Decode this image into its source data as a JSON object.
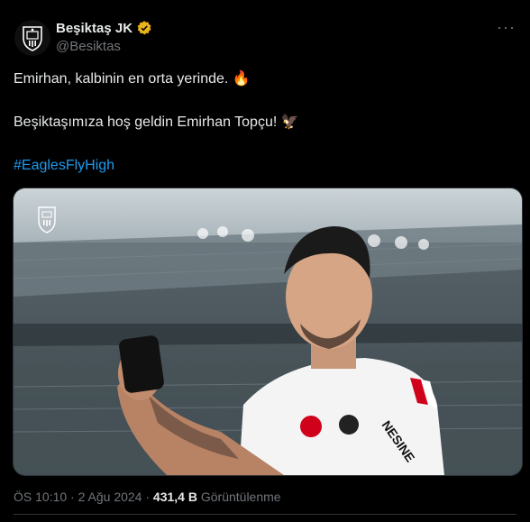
{
  "author": {
    "display_name": "Beşiktaş JK",
    "handle": "@Besiktas",
    "verified_color": "#e8b31b",
    "avatar_icon": "besiktas-crest-icon"
  },
  "more_icon": "more-options-icon",
  "tweet": {
    "line1": "Emirhan, kalbinin en orta yerinde. 🔥",
    "line2": "Beşiktaşımıza hoş geldin Emirhan Topçu! 🦅",
    "hashtag": "#EaglesFlyHigh"
  },
  "media": {
    "description_icon": "besiktas-logo-icon",
    "jersey_text": "NESINE"
  },
  "meta": {
    "time": "ÖS 10:10",
    "separator": "·",
    "date": "2 Ağu 2024",
    "views_count": "431,4 B",
    "views_label": "Görüntülenme"
  },
  "colors": {
    "background": "#000000",
    "text": "#e7e9ea",
    "secondary": "#71767b",
    "link": "#1d9bf0"
  }
}
